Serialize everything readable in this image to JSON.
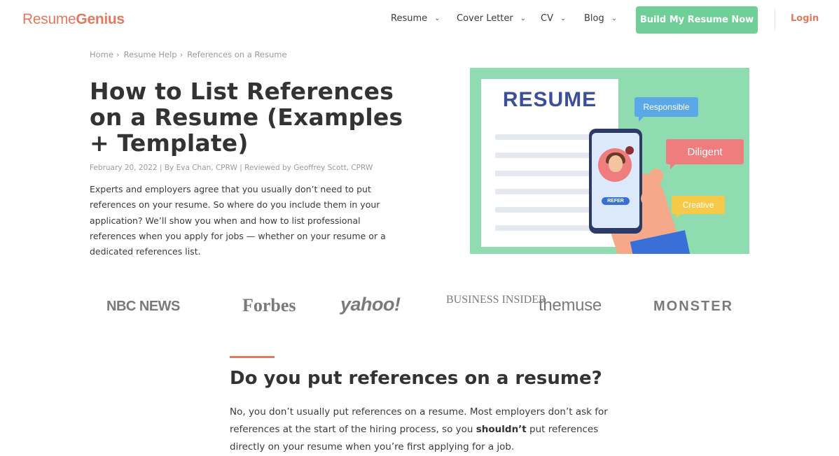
{
  "header": {
    "logo_part1": "Resume",
    "logo_part2": "Genius",
    "nav": [
      "Resume",
      "Cover Letter",
      "CV",
      "Blog"
    ],
    "cta_label": "Build My Resume Now",
    "login_label": "Login",
    "brand_color": "#e07a5f",
    "cta_color": "#6fcf97"
  },
  "breadcrumb": [
    "Home",
    "Resume Help",
    "References on a Resume"
  ],
  "article": {
    "title": "How to List References on a Resume (Examples + Template)",
    "meta": "February 20, 2022 | By Eva Chan, CPRW | Reviewed by Geoffrey Scott, CPRW",
    "intro": "Experts and employers agree that you usually don’t need to put references on your resume. So where do you include them in your application? We’ll show you when and how to list professional references when you apply for jobs — whether on your resume or a dedicated references list."
  },
  "hero": {
    "paper_title": "RESUME",
    "bubbles": [
      "Responsible",
      "Diligent",
      "Creative"
    ],
    "phone_badge": "REFER"
  },
  "press_logos": [
    "NBC NEWS",
    "Forbes",
    "yahoo!",
    "BUSINESS INSIDER",
    "themuse",
    "MONSTER"
  ],
  "section": {
    "heading": "Do you put references on a resume?",
    "para_part1": "No, you don’t usually put references on a resume. Most employers don’t ask for references at the start of the hiring process, so you ",
    "para_bold": "shouldn’t",
    "para_part2": " put references directly on your resume when you’re first applying for a job."
  }
}
